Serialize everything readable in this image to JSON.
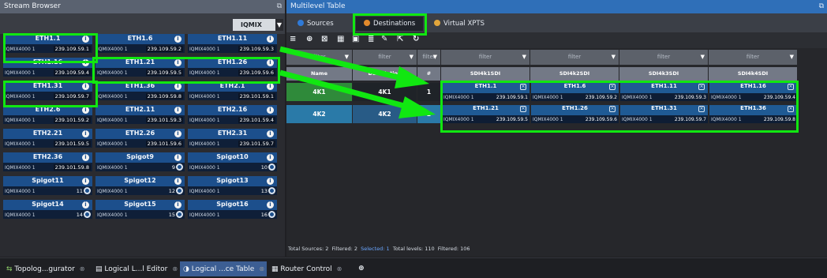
{
  "stream_browser": {
    "title": "Stream Browser",
    "filter_value": "IQMIX",
    "tiles": [
      {
        "name": "ETH1.1",
        "device": "IQMIX4000 1",
        "addr": "239.109.59.1"
      },
      {
        "name": "ETH1.6",
        "device": "IQMIX4000 1",
        "addr": "239.109.59.2"
      },
      {
        "name": "ETH1.11",
        "device": "IQMIX4000 1",
        "addr": "239.109.59.3"
      },
      {
        "name": "ETH1.16",
        "device": "IQMIX4000 1",
        "addr": "239.109.59.4"
      },
      {
        "name": "ETH1.21",
        "device": "IQMIX4000 1",
        "addr": "239.109.59.5"
      },
      {
        "name": "ETH1.26",
        "device": "IQMIX4000 1",
        "addr": "239.109.59.6"
      },
      {
        "name": "ETH1.31",
        "device": "IQMIX4000 1",
        "addr": "239.109.59.7"
      },
      {
        "name": "ETH1.36",
        "device": "IQMIX4000 1",
        "addr": "239.109.59.8"
      },
      {
        "name": "ETH2.1",
        "device": "IQMIX4000 1",
        "addr": "239.101.59.1"
      },
      {
        "name": "ETH2.6",
        "device": "IQMIX4000 1",
        "addr": "239.101.59.2"
      },
      {
        "name": "ETH2.11",
        "device": "IQMIX4000 1",
        "addr": "239.101.59.3"
      },
      {
        "name": "ETH2.16",
        "device": "IQMIX4000 1",
        "addr": "239.101.59.4"
      },
      {
        "name": "ETH2.21",
        "device": "IQMIX4000 1",
        "addr": "239.101.59.5"
      },
      {
        "name": "ETH2.26",
        "device": "IQMIX4000 1",
        "addr": "239.101.59.6"
      },
      {
        "name": "ETH2.31",
        "device": "IQMIX4000 1",
        "addr": "239.101.59.7"
      },
      {
        "name": "ETH2.36",
        "device": "IQMIX4000 1",
        "addr": "239.101.59.8"
      },
      {
        "name": "Spigot9",
        "device": "IQMIX4000 1",
        "num": "9"
      },
      {
        "name": "Spigot10",
        "device": "IQMIX4000 1",
        "num": "10"
      },
      {
        "name": "Spigot11",
        "device": "IQMIX4000 1",
        "num": "11"
      },
      {
        "name": "Spigot12",
        "device": "IQMIX4000 1",
        "num": "12"
      },
      {
        "name": "Spigot13",
        "device": "IQMIX4000 1",
        "num": "13"
      },
      {
        "name": "Spigot14",
        "device": "IQMIX4000 1",
        "num": "14"
      },
      {
        "name": "Spigot15",
        "device": "IQMIX4000 1",
        "num": "15"
      },
      {
        "name": "Spigot16",
        "device": "IQMIX4000 1",
        "num": "16"
      }
    ]
  },
  "multilevel_table": {
    "title": "Multilevel Table",
    "tabs": [
      {
        "label": "Sources"
      },
      {
        "label": "Destinations"
      },
      {
        "label": "Virtual XPTS"
      }
    ],
    "filter_placeholder": "filter",
    "columns": [
      "Name",
      "Description",
      "#",
      "SDI4k1SDI",
      "SDI4k2SDI",
      "SDI4k3SDI",
      "SDI4k4SDI"
    ],
    "rows": [
      {
        "name": "4K1",
        "description": "4K1",
        "num": "1",
        "cells": [
          {
            "name": "ETH1.1",
            "device": "IQMIX4000 1",
            "addr": "239.109.59.1"
          },
          {
            "name": "ETH1.6",
            "device": "IQMIX4000 1",
            "addr": "239.109.59.2"
          },
          {
            "name": "ETH1.11",
            "device": "IQMIX4000 1",
            "addr": "239.109.59.3"
          },
          {
            "name": "ETH1.16",
            "device": "IQMIX4000 1",
            "addr": "239.109.59.4"
          }
        ]
      },
      {
        "name": "4K2",
        "description": "4K2",
        "num": "2",
        "cells": [
          {
            "name": "ETH1.21",
            "device": "IQMIX4000 1",
            "addr": "239.109.59.5"
          },
          {
            "name": "ETH1.26",
            "device": "IQMIX4000 1",
            "addr": "239.109.59.6"
          },
          {
            "name": "ETH1.31",
            "device": "IQMIX4000 1",
            "addr": "239.109.59.7"
          },
          {
            "name": "ETH1.36",
            "device": "IQMIX4000 1",
            "addr": "239.109.59.8"
          }
        ]
      }
    ],
    "status": {
      "total_sources": "Total Sources: 2",
      "filtered": "Filtered: 2",
      "selected": "Selected: 1",
      "total_levels": "Total levels: 110",
      "filtered_levels": "Filtered: 106"
    }
  },
  "taskbar": {
    "items": [
      {
        "label": "Topolog...gurator"
      },
      {
        "label": "Logical L...l Editor"
      },
      {
        "label": "Logical ...ce Table"
      },
      {
        "label": "Router Control"
      }
    ]
  },
  "colors": {
    "highlight": "#11e711",
    "tile": "#1c4f8c",
    "accent": "#2f6fb8"
  }
}
